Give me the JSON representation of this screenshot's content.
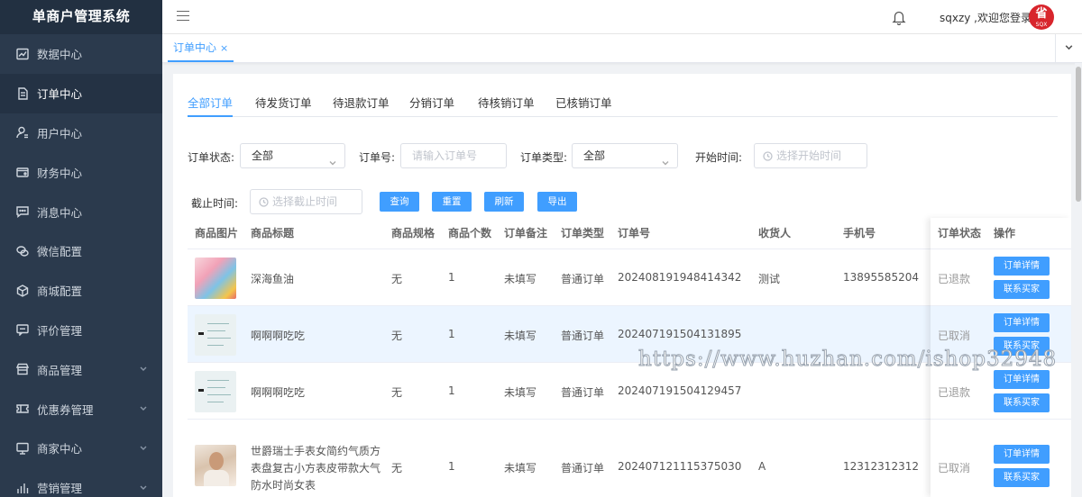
{
  "app": {
    "title": "单商户管理系统"
  },
  "sidebar": {
    "items": [
      {
        "label": "数据中心",
        "icon": "chart-icon"
      },
      {
        "label": "订单中心",
        "icon": "document-icon",
        "active": true
      },
      {
        "label": "用户中心",
        "icon": "user-icon"
      },
      {
        "label": "财务中心",
        "icon": "wallet-icon"
      },
      {
        "label": "消息中心",
        "icon": "message-icon"
      },
      {
        "label": "微信配置",
        "icon": "wechat-icon"
      },
      {
        "label": "商城配置",
        "icon": "cube-icon"
      },
      {
        "label": "评价管理",
        "icon": "comment-icon"
      },
      {
        "label": "商品管理",
        "icon": "shop-icon",
        "expandable": true
      },
      {
        "label": "优惠券管理",
        "icon": "coupon-icon",
        "expandable": true
      },
      {
        "label": "商家中心",
        "icon": "monitor-icon",
        "expandable": true
      },
      {
        "label": "营销管理",
        "icon": "bar-chart-icon",
        "expandable": true
      }
    ]
  },
  "header": {
    "welcome": "sqxzy ,欢迎您登录",
    "avatar_text": "省",
    "avatar_sub": "SQX",
    "avatar_color": "#d8252c"
  },
  "tabbar": {
    "active_tab": "订单中心",
    "close": "×"
  },
  "order_tabs": [
    "全部订单",
    "待发货订单",
    "待退款订单",
    "分销订单",
    "待核销订单",
    "已核销订单"
  ],
  "filters": {
    "status_label": "订单状态:",
    "status_value": "全部",
    "order_no_label": "订单号:",
    "order_no_placeholder": "请输入订单号",
    "type_label": "订单类型:",
    "type_value": "全部",
    "start_label": "开始时间:",
    "start_placeholder": "选择开始时间",
    "end_label": "截止时间:",
    "end_placeholder": "选择截止时间"
  },
  "buttons": {
    "query": "查询",
    "reset": "重置",
    "refresh": "刷新",
    "export": "导出"
  },
  "table": {
    "headers": [
      "商品图片",
      "商品标题",
      "商品规格",
      "商品个数",
      "订单备注",
      "订单类型",
      "订单号",
      "收货人",
      "手机号",
      "订单状态",
      "操作"
    ],
    "action_detail": "订单详情",
    "action_contact": "联系买家",
    "rows": [
      {
        "title_lines": [
          "深海鱼油"
        ],
        "spec": "无",
        "count": "1",
        "remark": "未填写",
        "type": "普通订单",
        "order_no": "202408191948414342",
        "receiver": "测试",
        "phone": "13895585204",
        "status": "已退款"
      },
      {
        "title_lines": [
          "啊啊啊吃吃"
        ],
        "spec": "无",
        "count": "1",
        "remark": "未填写",
        "type": "普通订单",
        "order_no": "202407191504131895",
        "receiver": "",
        "phone": "",
        "status": "已取消"
      },
      {
        "title_lines": [
          "啊啊啊吃吃"
        ],
        "spec": "无",
        "count": "1",
        "remark": "未填写",
        "type": "普通订单",
        "order_no": "202407191504129457",
        "receiver": "",
        "phone": "",
        "status": "已退款"
      },
      {
        "title_lines": [
          "世爵瑞士手表女简约气质方",
          "表盘复古小方表皮带款大气",
          "防水时尚女表"
        ],
        "spec": "无",
        "count": "1",
        "remark": "未填写",
        "type": "普通订单",
        "order_no": "202407121115375030",
        "receiver": "A",
        "phone": "12312312312",
        "status": "已取消"
      }
    ]
  },
  "watermark": "https://www.huzhan.com/ishop32948",
  "accent_color": "#409eff"
}
